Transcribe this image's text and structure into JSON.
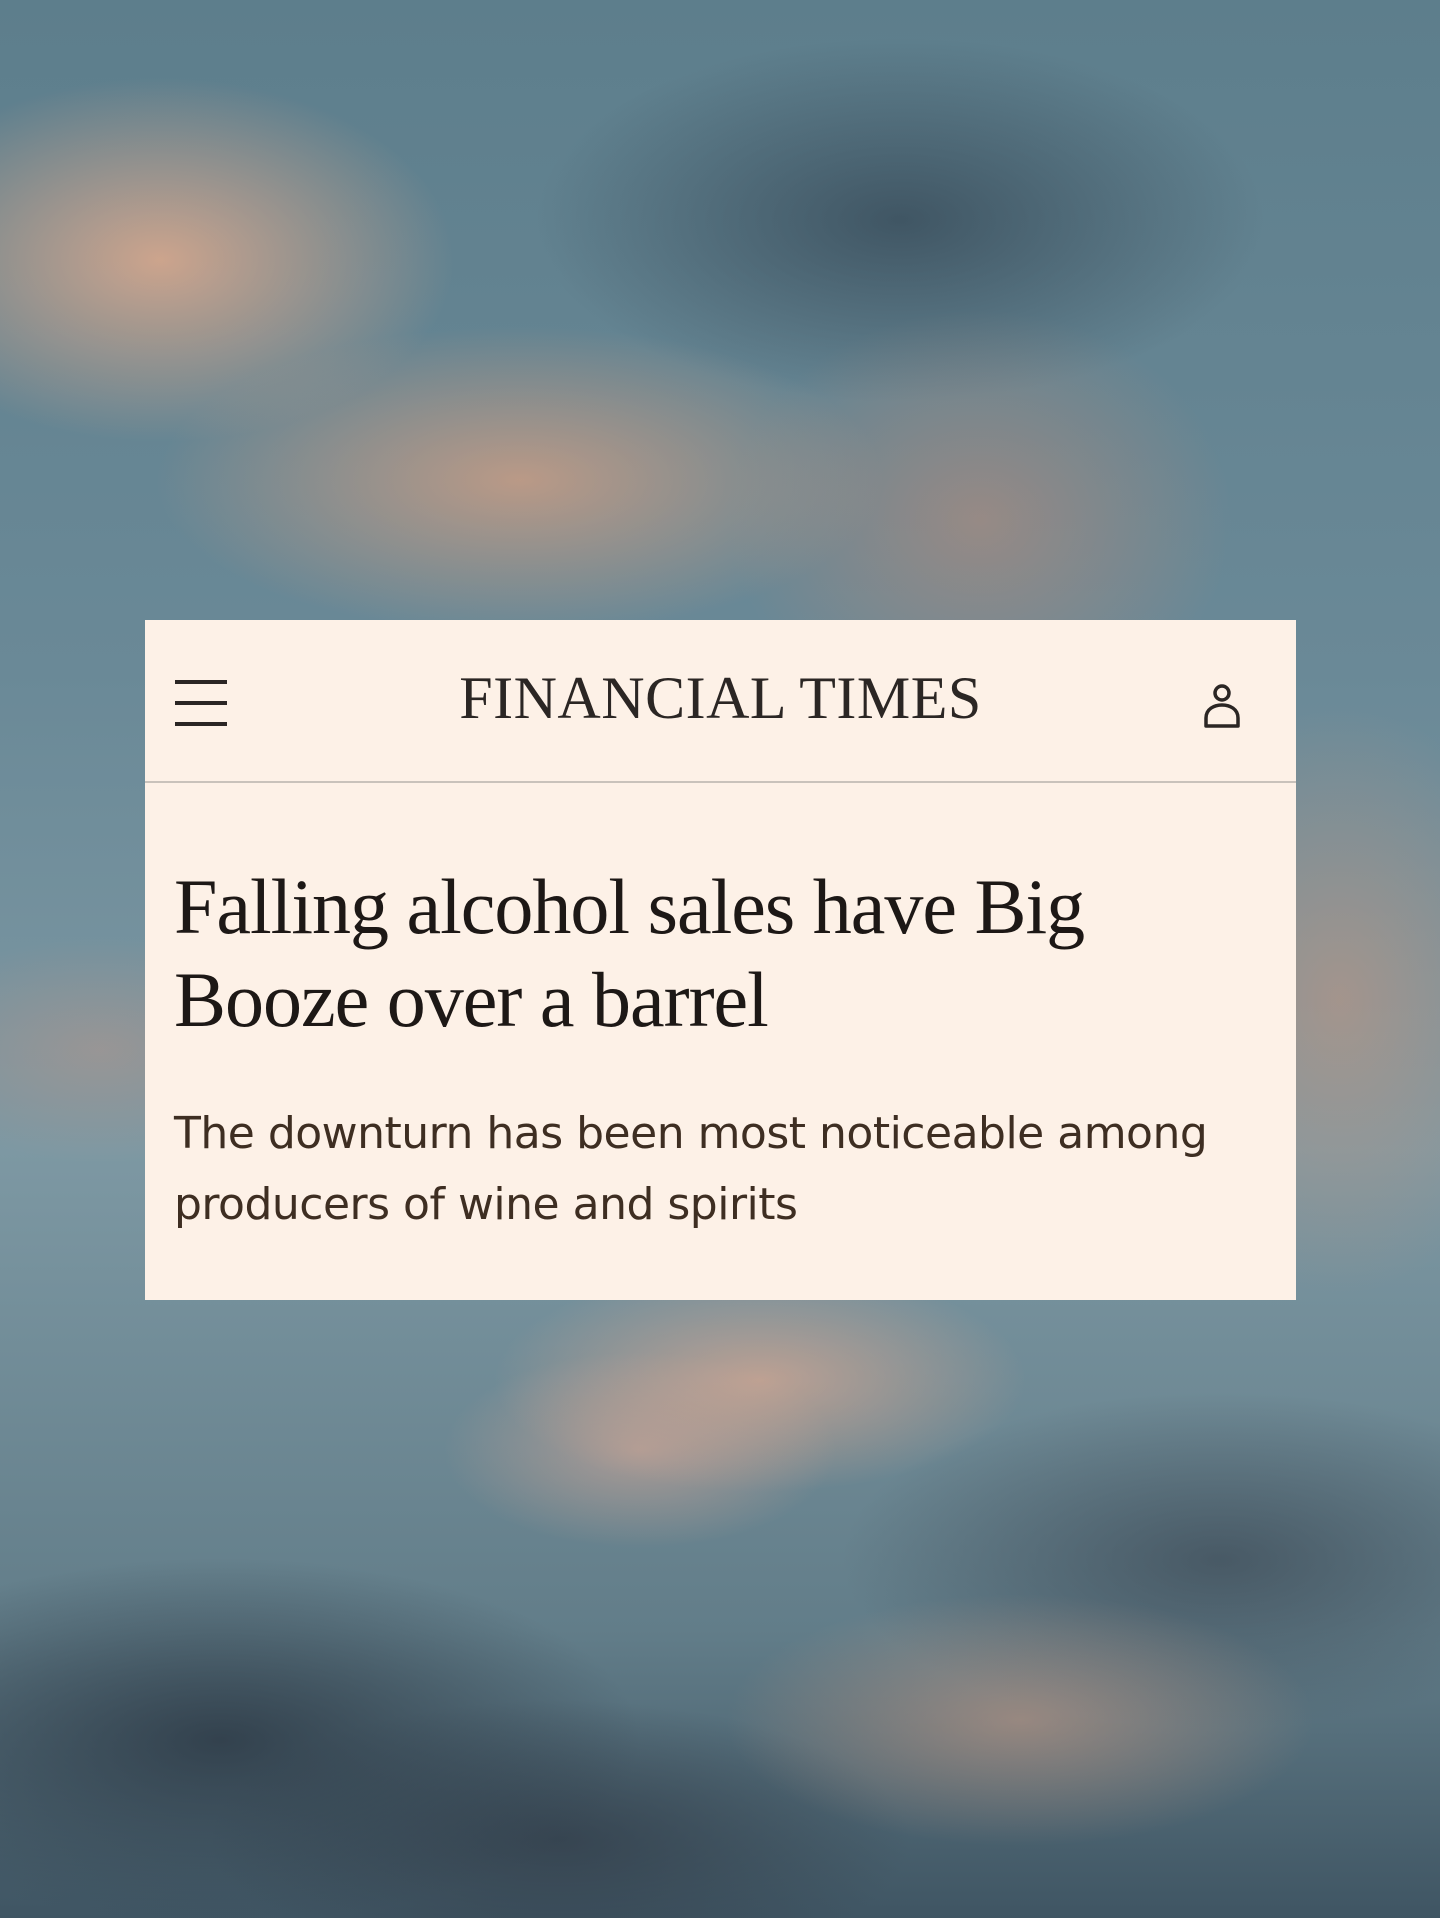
{
  "masthead": {
    "title": "FINANCIAL TIMES"
  },
  "icons": {
    "menu": "hamburger-menu-icon",
    "account": "user-account-icon"
  },
  "article": {
    "headline": "Falling alcohol sales have Big Booze over a barrel",
    "standfirst": "The downturn has been most noticeable among producers of wine and spirits"
  },
  "colors": {
    "card_background": "#fdf1e7",
    "text_primary": "#1d1816",
    "standfirst_text": "#3e2e22",
    "divider": "#c9c2bb"
  }
}
